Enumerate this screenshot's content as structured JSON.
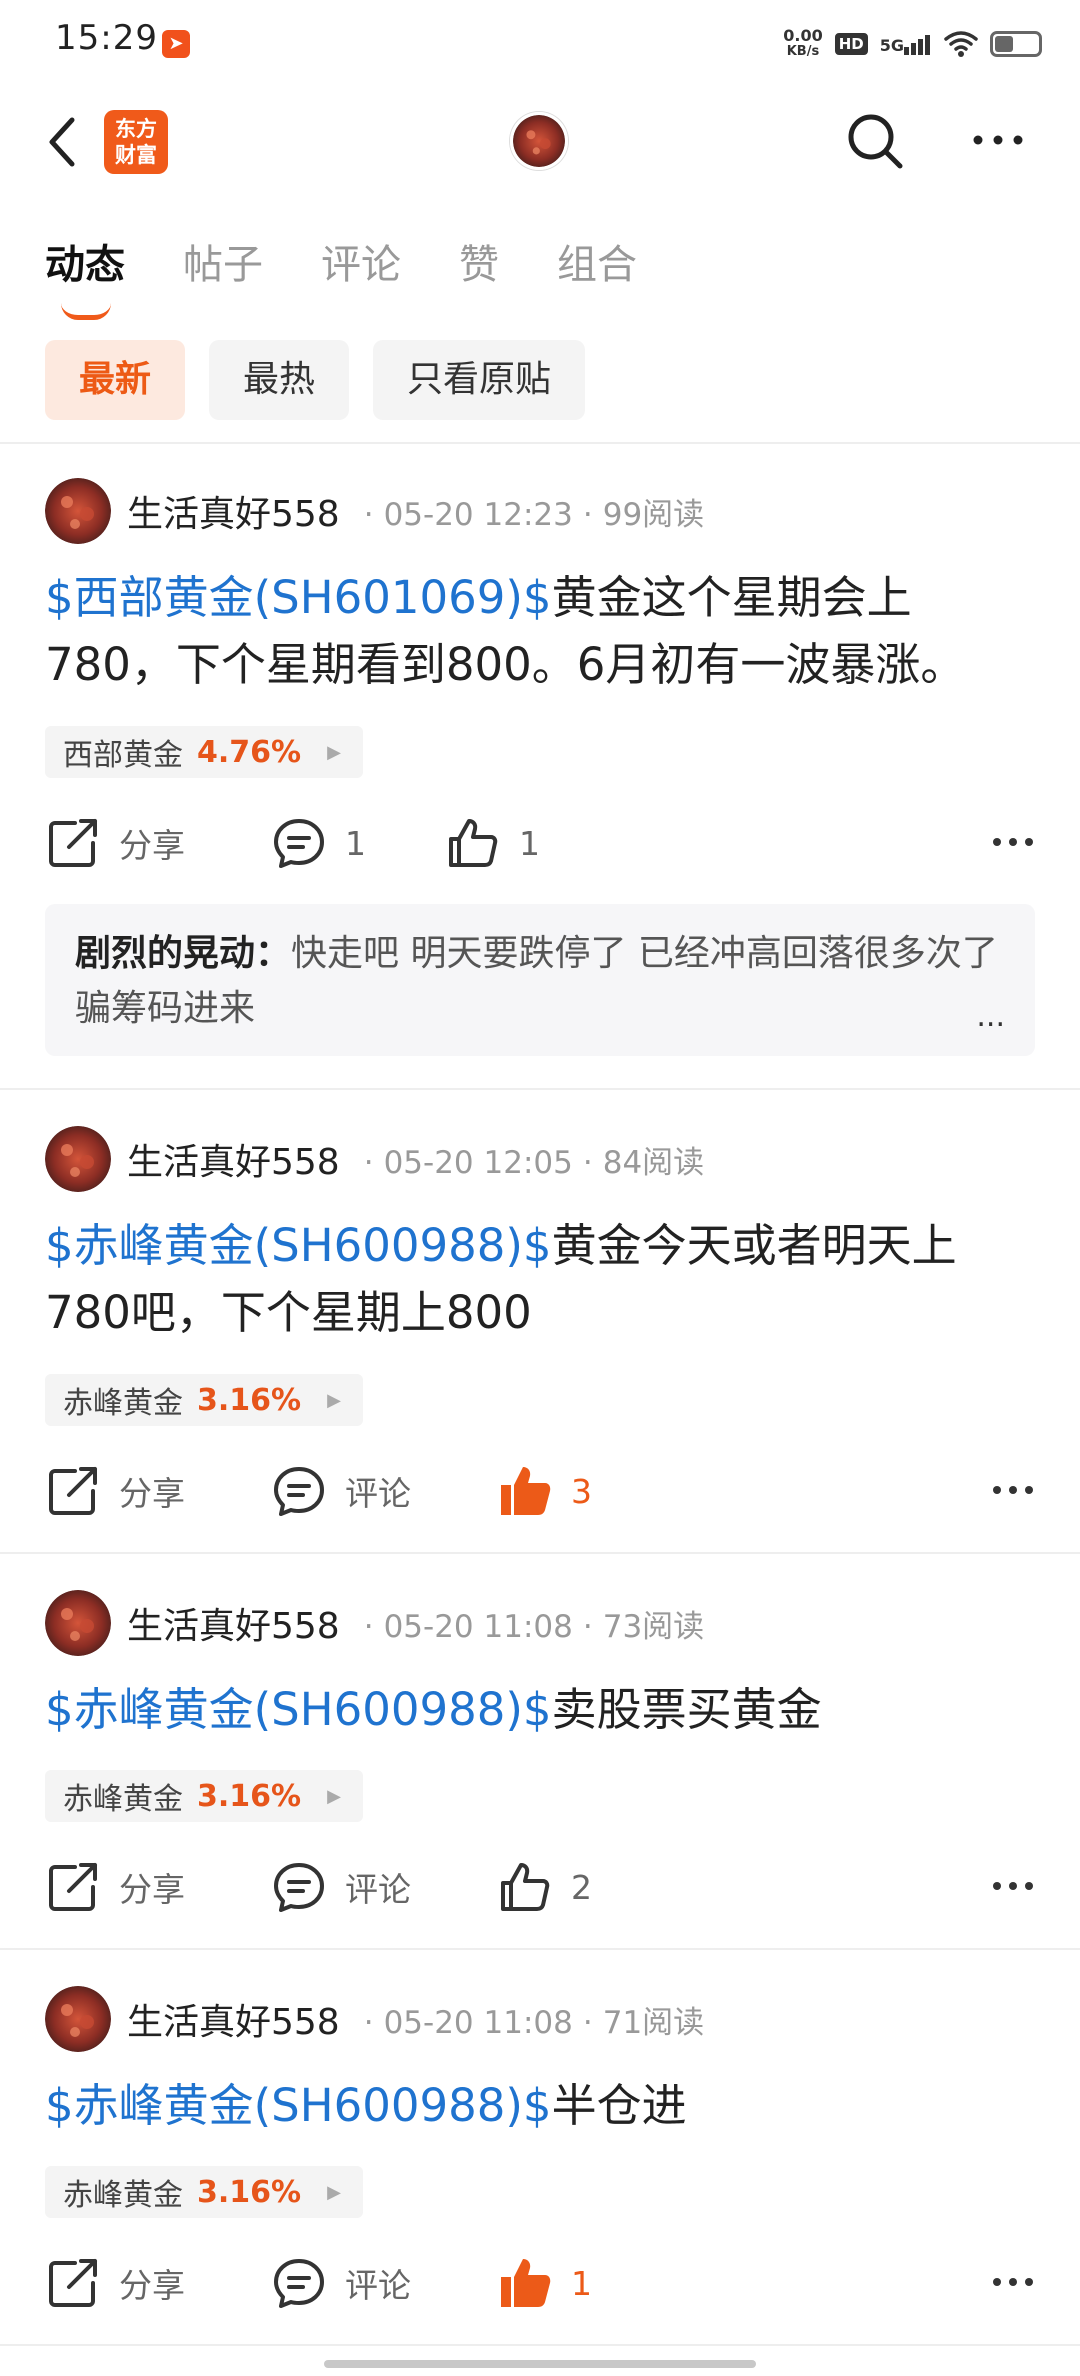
{
  "status_bar": {
    "time": "15:29",
    "net_speed": "0.00",
    "net_unit": "KB/s",
    "hd": "HD",
    "network": "5G"
  },
  "nav": {
    "logo_line1": "东方",
    "logo_line2": "财富"
  },
  "tabs": [
    "动态",
    "帖子",
    "评论",
    "赞",
    "组合"
  ],
  "filters": [
    "最新",
    "最热",
    "只看原贴"
  ],
  "actions_labels": {
    "share": "分享",
    "comment": "评论"
  },
  "posts": [
    {
      "author": "生活真好558",
      "time": "05-20 12:23",
      "reads": "99阅读",
      "stock_tag": "$西部黄金(SH601069)$",
      "text": "黄金这个星期会上780，下个星期看到800。6月初有一波暴涨。",
      "quote_name": "西部黄金",
      "quote_pct": "4.76%",
      "comment_count": "1",
      "like_count": "1",
      "liked": false,
      "top_comment": {
        "name": "剧烈的晃动：",
        "text": "快走吧 明天要跌停了 已经冲高回落很多次了 骗筹码进来",
        "ellipsis": "..."
      }
    },
    {
      "author": "生活真好558",
      "time": "05-20 12:05",
      "reads": "84阅读",
      "stock_tag": "$赤峰黄金(SH600988)$",
      "text": "黄金今天或者明天上780吧，下个星期上800",
      "quote_name": "赤峰黄金",
      "quote_pct": "3.16%",
      "comment_count": "评论",
      "like_count": "3",
      "liked": true
    },
    {
      "author": "生活真好558",
      "time": "05-20 11:08",
      "reads": "73阅读",
      "stock_tag": "$赤峰黄金(SH600988)$",
      "text": "卖股票买黄金",
      "quote_name": "赤峰黄金",
      "quote_pct": "3.16%",
      "comment_count": "评论",
      "like_count": "2",
      "liked": false
    },
    {
      "author": "生活真好558",
      "time": "05-20 11:08",
      "reads": "71阅读",
      "stock_tag": "$赤峰黄金(SH600988)$",
      "text": "半仓进",
      "quote_name": "赤峰黄金",
      "quote_pct": "3.16%",
      "comment_count": "评论",
      "like_count": "1",
      "liked": true
    }
  ],
  "colors": {
    "accent": "#ed5a15",
    "stock_link": "#1f73cf",
    "chip_active_bg": "#fde9df"
  }
}
